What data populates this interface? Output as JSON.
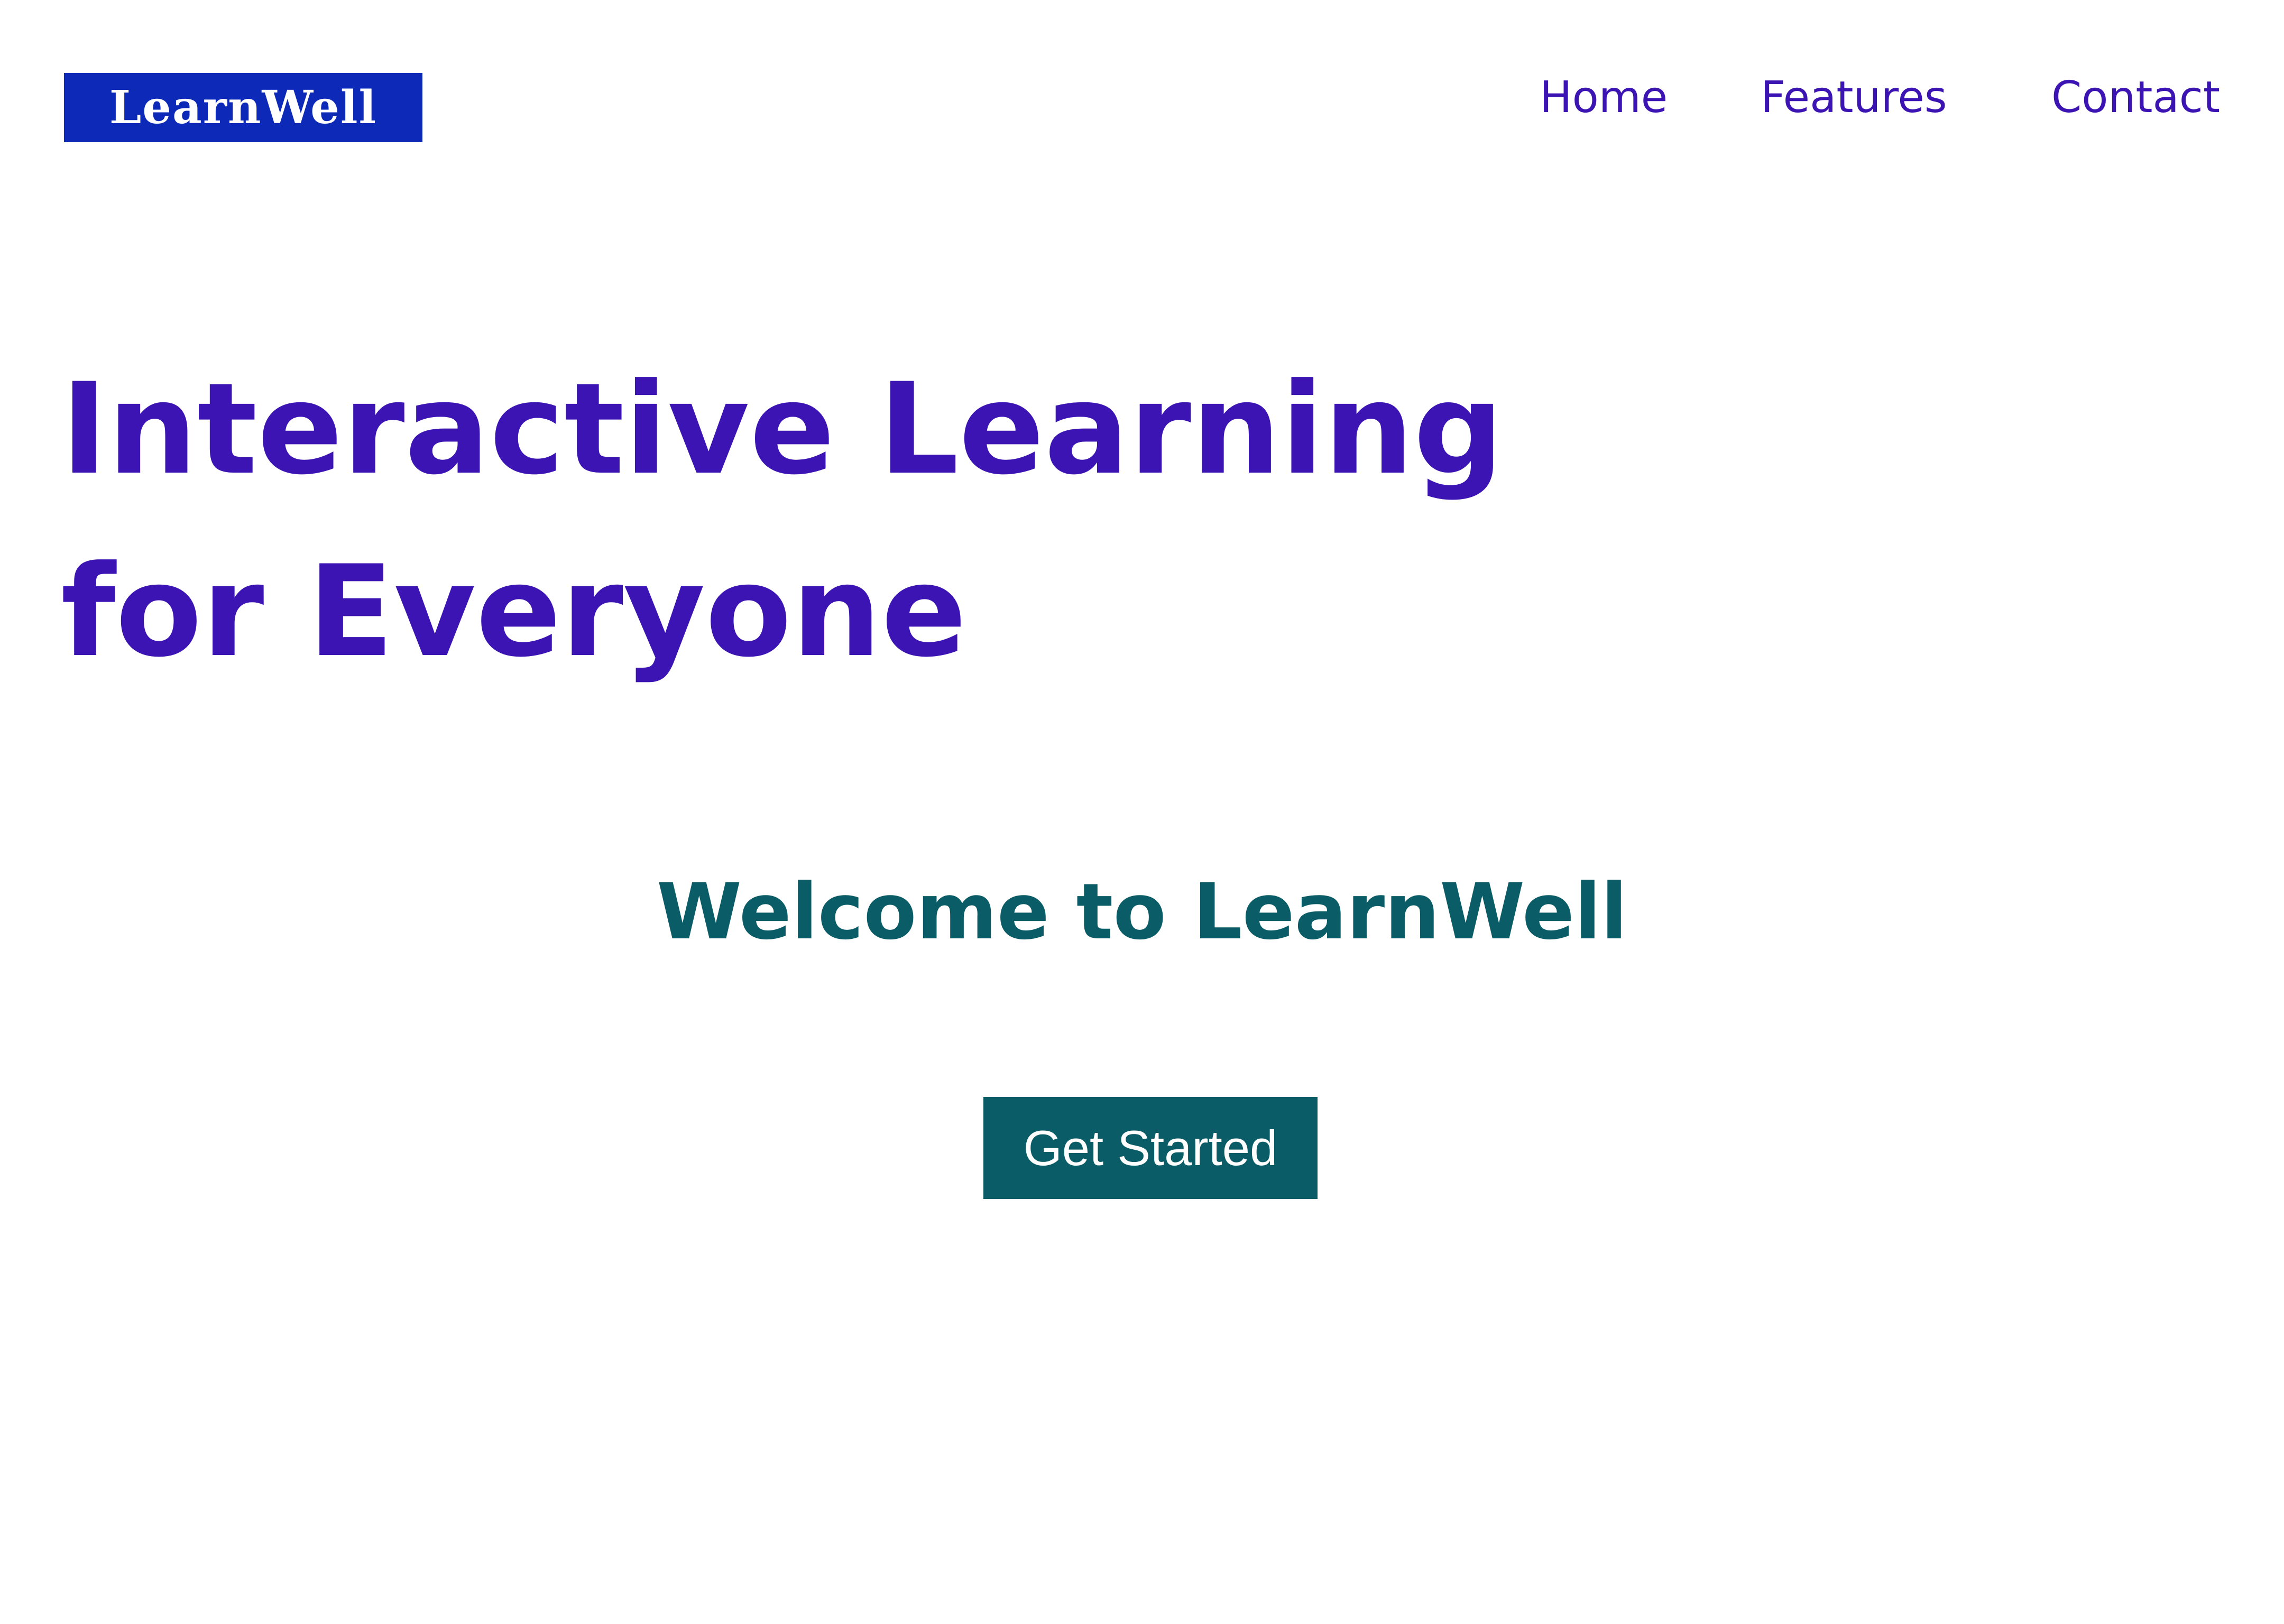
{
  "header": {
    "logo_text": "LearnWell",
    "nav": [
      {
        "label": "Home"
      },
      {
        "label": "Features"
      },
      {
        "label": "Contact"
      }
    ]
  },
  "hero": {
    "title_line1": "Interactive Learning",
    "title_line2": "for Everyone",
    "welcome": "Welcome to LearnWell",
    "cta_label": "Get Started"
  },
  "colors": {
    "logo_bg": "#0c29b8",
    "primary_text": "#3b14b3",
    "accent": "#0a5c66",
    "background": "#ffffff"
  }
}
